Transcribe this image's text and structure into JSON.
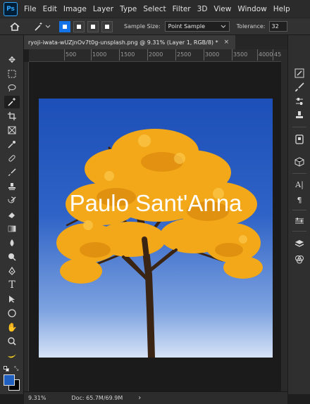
{
  "menubar": {
    "logo": "Ps",
    "items": [
      "File",
      "Edit",
      "Image",
      "Layer",
      "Type",
      "Select",
      "Filter",
      "3D",
      "View",
      "Window",
      "Help"
    ]
  },
  "options": {
    "sample_size_label": "Sample Size:",
    "sample_size_value": "Point Sample",
    "tolerance_label": "Tolerance:",
    "tolerance_value": "32"
  },
  "document": {
    "tab_title": "ryoji-iwata-wUZjnOv7t0g-unsplash.png @ 9.31% (Layer 1, RGB/8) *",
    "close_glyph": "×",
    "overlay_text": "Paulo Sant'Anna"
  },
  "ruler": {
    "top_ticks": [
      "500",
      "1000",
      "1500",
      "2000",
      "2500",
      "3000",
      "3500",
      "4000",
      "45"
    ]
  },
  "status": {
    "zoom": "9.31%",
    "doc_info": "Doc: 65.7M/69.9M",
    "arrow": "›"
  },
  "colors": {
    "accent": "#1473e6",
    "foreground_swatch": "#1f5fbf",
    "background_swatch": "#000000",
    "sky_top": "#1d4fb8",
    "foliage": "#f2a818"
  },
  "icons": {
    "toolbar": [
      "move-icon",
      "marquee-icon",
      "lasso-icon",
      "magic-wand-icon",
      "crop-icon",
      "frame-icon",
      "eyedropper-icon",
      "healing-brush-icon",
      "brush-icon",
      "clone-stamp-icon",
      "history-brush-icon",
      "eraser-icon",
      "gradient-icon",
      "blur-icon",
      "dodge-icon",
      "pen-icon",
      "type-icon",
      "path-selection-icon",
      "ellipse-icon",
      "hand-icon",
      "zoom-icon",
      "banana-icon"
    ],
    "right_panel": [
      "history-icon",
      "brush-panel-icon",
      "adjust-icon",
      "stamp-icon",
      "libraries-icon",
      "3d-icon",
      "character-icon",
      "paragraph-icon",
      "properties-icon",
      "layers-icon",
      "channels-icon"
    ]
  }
}
